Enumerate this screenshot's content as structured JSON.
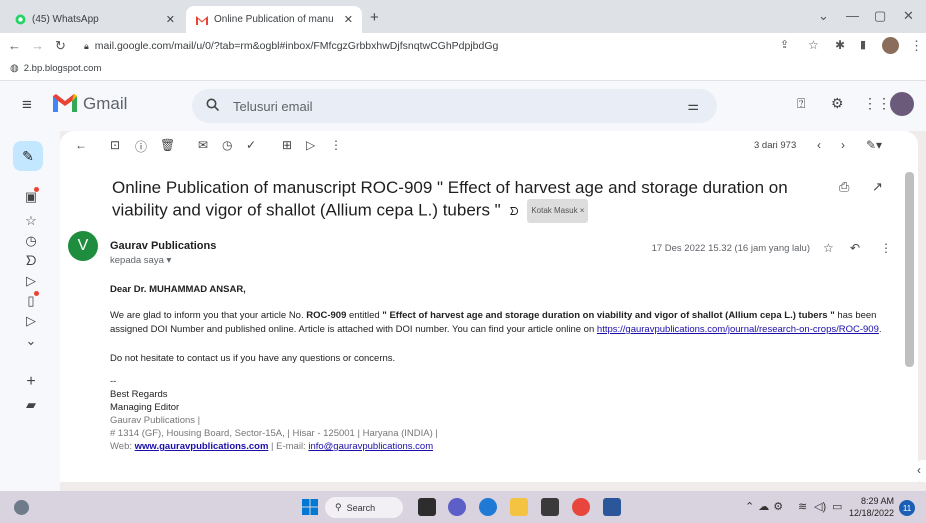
{
  "browser": {
    "tabs": [
      {
        "label": "(45) WhatsApp",
        "favicon": "whatsapp-icon"
      },
      {
        "label": "Online Publication of manuscript",
        "favicon": "gmail-icon"
      }
    ],
    "new_tab": "+",
    "url": "mail.google.com/mail/u/0/?tab=rm&ogbl#inbox/FMfcgzGrbbxhwDjfsnqtwCGhPdpjbdGg",
    "bookmark": "2.bp.blogspot.com"
  },
  "gmail": {
    "brand": "Gmail",
    "search_placeholder": "Telusuri email",
    "pagination": "3 dari 973",
    "subject": "Online Publication of manuscript ROC-909 \" Effect of harvest age and storage duration on viability and vigor of shallot (Allium cepa L.) tubers \"",
    "label": "Kotak Masuk ×",
    "avatar_letter": "V",
    "sender": "Gaurav Publications",
    "recipient": "kepada saya ▾",
    "date": "17 Des 2022 15.32 (16 jam yang lalu)",
    "greeting": "Dear Dr. MUHAMMAD ANSAR,",
    "para1_a": "We are glad to inform you that your article No.",
    "para1_id": "ROC-909",
    "para1_b": "entitled",
    "para1_title": "\" Effect of harvest age and storage duration on viability and vigor of shallot (Allium cepa L.) tubers \"",
    "para1_c": "has been assigned DOI Number and published online. Article is attached with DOI number. You can find your article online on",
    "para1_link": "https://gauravpublications.com/journal/research-on-crops/ROC-909",
    "para1_end": ".",
    "para2": "Do not hesitate to contact us if you have any questions or concerns.",
    "dashes": "--",
    "sig_regards": "Best Regards",
    "sig_role": "Managing Editor",
    "sig_company": "Gaurav Publications |",
    "sig_address": "# 1314 (GF), Housing Board, Sector-15A, | Hisar - 125001 | Haryana (INDIA) |",
    "sig_web_label": "Web:",
    "sig_web": "www.gauravpublications.com",
    "sig_email_label": "| E-mail:",
    "sig_email": "info@gauravpublications.com"
  },
  "taskbar": {
    "search": "Search",
    "time": "8:29 AM",
    "date": "12/18/2022",
    "notifications": "11"
  },
  "colors": {
    "gmail_red": "#ea4335",
    "avatar_green": "#1e8e3e",
    "link_blue": "#1a0dab"
  }
}
